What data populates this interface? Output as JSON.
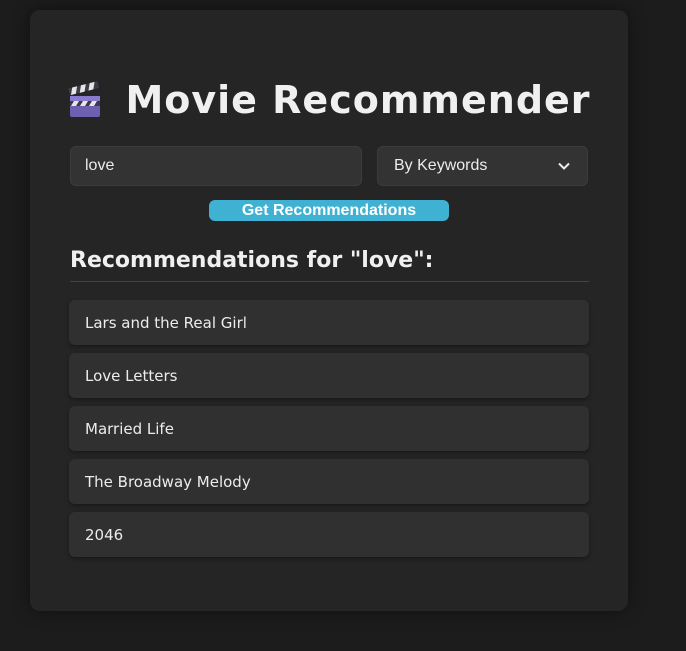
{
  "app": {
    "title": "Movie Recommender"
  },
  "search": {
    "value": "love",
    "placeholder": ""
  },
  "mode_select": {
    "selected": "By Keywords"
  },
  "actions": {
    "recommend_label": "Get Recommendations"
  },
  "results": {
    "heading": "Recommendations for \"love\":",
    "items": [
      "Lars and the Real Girl",
      "Love Letters",
      "Married Life",
      "The Broadway Melody",
      "2046"
    ]
  },
  "colors": {
    "page_background": "#1c1c1c",
    "card_background": "#252525",
    "accent": "#3fb1d2",
    "item_background": "#303030"
  },
  "icons": {
    "title_icon": "clapperboard-icon",
    "select_icon": "chevron-down-icon"
  }
}
